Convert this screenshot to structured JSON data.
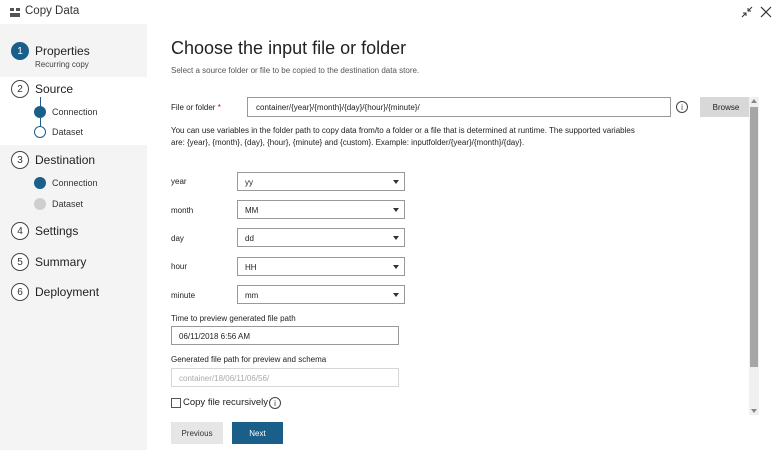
{
  "window": {
    "title": "Copy Data"
  },
  "steps": [
    {
      "num": "1",
      "label": "Properties",
      "sub": "Recurring copy"
    },
    {
      "num": "2",
      "label": "Source",
      "substeps": [
        "Connection",
        "Dataset"
      ]
    },
    {
      "num": "3",
      "label": "Destination",
      "substeps": [
        "Connection",
        "Dataset"
      ]
    },
    {
      "num": "4",
      "label": "Settings"
    },
    {
      "num": "5",
      "label": "Summary"
    },
    {
      "num": "6",
      "label": "Deployment"
    }
  ],
  "main": {
    "title": "Choose the input file or folder",
    "subtitle": "Select a source folder or file to be copied to the destination data store.",
    "file_label": "File or folder",
    "required_mark": "*",
    "path_value": "container/{year}/{month}/{day}/{hour}/{minute}/",
    "browse_label": "Browse",
    "help_text": "You can use variables in the folder path to copy data from/to a folder or a file that is determined at runtime. The supported variables are: {year}, {month}, {day}, {hour}, {minute} and {custom}. Example: inputfolder/{year}/{month}/{day}.",
    "variables": [
      {
        "label": "year",
        "value": "yy"
      },
      {
        "label": "month",
        "value": "MM"
      },
      {
        "label": "day",
        "value": "dd"
      },
      {
        "label": "hour",
        "value": "HH"
      },
      {
        "label": "minute",
        "value": "mm"
      }
    ],
    "preview_time_label": "Time to preview generated file path",
    "preview_time_value": "06/11/2018 6:56 AM",
    "generated_path_label": "Generated file path for preview and schema",
    "generated_path_value": "container/18/06/11/06/56/",
    "recursive_label": "Copy file recursively",
    "previous_label": "Previous",
    "next_label": "Next"
  },
  "colors": {
    "accent": "#1a5f8a",
    "sidebar_bg": "#f4f4f4"
  },
  "icons": [
    "copy-data-app-icon",
    "restore-icon",
    "close-icon",
    "info-icon",
    "chevron-down-icon"
  ]
}
